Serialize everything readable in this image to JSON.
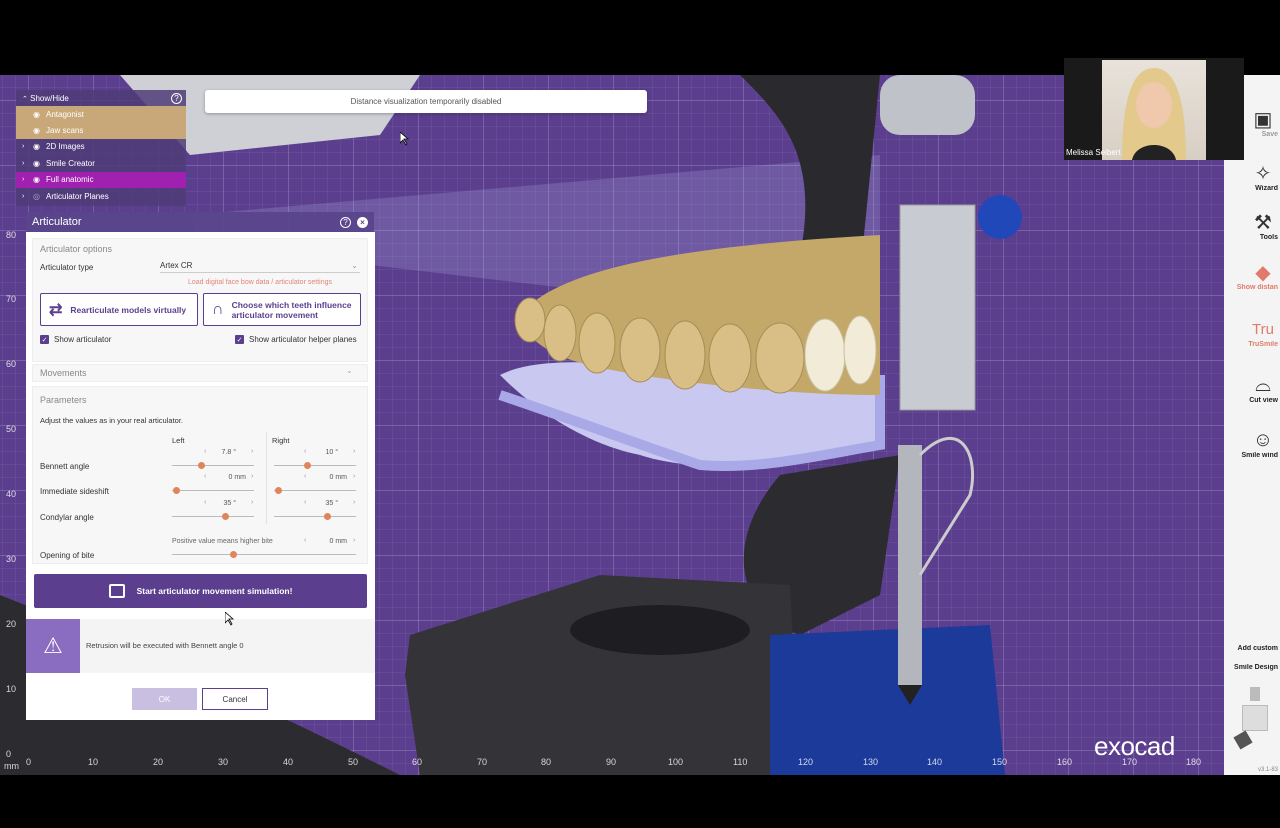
{
  "banner": {
    "text": "Distance visualization temporarily disabled"
  },
  "show_hide": {
    "title": "Show/Hide",
    "help": "?",
    "items": [
      {
        "label": "Antagonist",
        "style": "tan",
        "visible": true
      },
      {
        "label": "Jaw scans",
        "style": "tan",
        "visible": true
      },
      {
        "label": "2D Images",
        "style": "normal",
        "visible": true
      },
      {
        "label": "Smile Creator",
        "style": "normal",
        "visible": true
      },
      {
        "label": "Full anatomic",
        "style": "magenta",
        "visible": true
      },
      {
        "label": "Articulator Planes",
        "style": "normal",
        "visible": false
      }
    ]
  },
  "articulator": {
    "title": "Articulator",
    "help": "?",
    "close": "×",
    "options_title": "Articulator options",
    "type_label": "Articulator type",
    "type_value": "Artex CR",
    "load_link": "Load digital face bow data / articulator settings",
    "rearticulate_btn": "Rearticulate models virtually",
    "choose_teeth_btn": "Choose which teeth influence articulator movement",
    "show_articulator": "Show articulator",
    "show_helper_planes": "Show articulator helper planes",
    "movements_title": "Movements",
    "parameters_title": "Parameters",
    "parameters_desc": "Adjust the values as in your real articulator.",
    "col_left": "Left",
    "col_right": "Right",
    "bennett_label": "Bennett angle",
    "bennett_left": "7.8 °",
    "bennett_right": "10 °",
    "bennett_left_pos": 0.35,
    "bennett_right_pos": 0.4,
    "sideshift_label": "Immediate sideshift",
    "sideshift_left": "0 mm",
    "sideshift_right": "0 mm",
    "sideshift_left_pos": 0.05,
    "sideshift_right_pos": 0.05,
    "condylar_label": "Condylar angle",
    "condylar_left": "35 °",
    "condylar_right": "35 °",
    "condylar_left_pos": 0.65,
    "condylar_right_pos": 0.65,
    "opening_label": "Opening of bite",
    "opening_hint": "Positive value means higher bite",
    "opening_value": "0 mm",
    "opening_pos": 0.33,
    "start_btn": "Start articulator movement simulation!",
    "warning": "Retrusion will be executed with Bennett angle 0",
    "ok": "OK",
    "cancel": "Cancel"
  },
  "toolbar": {
    "items": [
      {
        "label": "Save",
        "icon": "save-icon"
      },
      {
        "label": "Wizard",
        "icon": "wand-icon"
      },
      {
        "label": "Tools",
        "icon": "tools-icon"
      },
      {
        "label": "Show distan",
        "icon": "distance-icon"
      },
      {
        "label": "TruSmile",
        "icon": "trusmile-icon"
      },
      {
        "label": "Cut view",
        "icon": "cut-view-icon"
      },
      {
        "label": "Smile wind",
        "icon": "smile-window-icon"
      },
      {
        "label": "Add custom",
        "icon": ""
      },
      {
        "label": "Smile Design",
        "icon": ""
      }
    ],
    "version": "v3.1-83"
  },
  "ruler": {
    "y": [
      "80",
      "70",
      "60",
      "50",
      "40",
      "30",
      "20",
      "10",
      "0"
    ],
    "x": [
      "0",
      "10",
      "20",
      "30",
      "40",
      "50",
      "60",
      "70",
      "80",
      "90",
      "100",
      "110",
      "120",
      "130",
      "140",
      "150",
      "160",
      "170",
      "180"
    ],
    "unit": "mm"
  },
  "webcam": {
    "name": "Melissa Seibert"
  },
  "brand": {
    "logo": "exocad"
  },
  "colors": {
    "accent": "#5b3f8e",
    "viewport": "#5b3f8e",
    "warning": "#e0857a"
  }
}
